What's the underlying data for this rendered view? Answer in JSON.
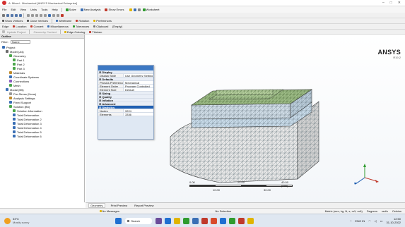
{
  "window": {
    "title": "A: Mixed - Mechanical [ANSYS Mechanical Enterprise]",
    "controls": [
      "–",
      "□",
      "✕"
    ]
  },
  "menu": [
    "File",
    "Edit",
    "View",
    "Units",
    "Tools",
    "Help"
  ],
  "toolbar1": {
    "solve": "Solve",
    "new_analysis": "New Analysis",
    "show_errors": "Show Errors",
    "worksheet": "Worksheet"
  },
  "toolbar2": {
    "show_vertices": "Show Vertices",
    "close_vertices": "Close Vertices",
    "wireframe": "Wireframe",
    "rotation": "Rotation",
    "preferences": "Preferences"
  },
  "toolbar3": {
    "edge": "Edge",
    "location": "Location",
    "convert": "Convert",
    "miscellaneous": "Miscellaneous",
    "tolerances": "Tolerances",
    "clipboard": "Clipboard",
    "empty": "[Empty]"
  },
  "toolbar4": {
    "update_project": "Update Project",
    "geometry_context": "Geometry Context",
    "edge_coloring": "Edge Coloring",
    "thicken": "Thicken"
  },
  "toolbar5": {
    "mesh": "Mesh",
    "update": "Update",
    "mesh2": "Mesh",
    "mesh_control": "Mesh Control",
    "metric_graph": "Metric Graph"
  },
  "outline": {
    "title": "Outline",
    "filter_label": "Filter:",
    "filter_value": "Name",
    "items": [
      {
        "label": "Project",
        "depth": 0,
        "color": "#3a6fb5"
      },
      {
        "label": "Model (A4)",
        "depth": 1,
        "color": "#6c6c6c"
      },
      {
        "label": "Geometry",
        "depth": 2,
        "color": "#4aa64a"
      },
      {
        "label": "Part 1",
        "depth": 3,
        "color": "#4aa64a"
      },
      {
        "label": "Part 2",
        "depth": 3,
        "color": "#4aa64a"
      },
      {
        "label": "Part 3",
        "depth": 3,
        "color": "#4aa64a"
      },
      {
        "label": "Materials",
        "depth": 2,
        "color": "#c08a2a"
      },
      {
        "label": "Coordinate Systems",
        "depth": 2,
        "color": "#3a6fb5"
      },
      {
        "label": "Connections",
        "depth": 2,
        "color": "#8a5cc0"
      },
      {
        "label": "Mesh",
        "depth": 2,
        "color": "#4aa64a"
      },
      {
        "label": "Modal (B5)",
        "depth": 1,
        "color": "#3a6fb5"
      },
      {
        "label": "Pre-Stress (None)",
        "depth": 2,
        "color": "#999999"
      },
      {
        "label": "Analysis Settings",
        "depth": 2,
        "color": "#c08a2a"
      },
      {
        "label": "Fixed Support",
        "depth": 2,
        "color": "#3a6fb5"
      },
      {
        "label": "Solution (B6)",
        "depth": 2,
        "color": "#4aa64a"
      },
      {
        "label": "Solution Information",
        "depth": 3,
        "color": "#4aa64a"
      },
      {
        "label": "Total Deformation",
        "depth": 3,
        "color": "#3a6fb5"
      },
      {
        "label": "Total Deformation 2",
        "depth": 3,
        "color": "#3a6fb5"
      },
      {
        "label": "Total Deformation 3",
        "depth": 3,
        "color": "#3a6fb5"
      },
      {
        "label": "Total Deformation 4",
        "depth": 3,
        "color": "#3a6fb5"
      },
      {
        "label": "Total Deformation 5",
        "depth": 3,
        "color": "#3a6fb5"
      },
      {
        "label": "Total Deformation 6",
        "depth": 3,
        "color": "#3a6fb5"
      }
    ]
  },
  "details": {
    "rows": [
      {
        "type": "section",
        "label": "Display"
      },
      {
        "type": "prop",
        "k": "Display Style",
        "v": "Use Geometry Setting"
      },
      {
        "type": "section",
        "label": "Defaults"
      },
      {
        "type": "prop",
        "k": "Physics Preference",
        "v": "Mechanical"
      },
      {
        "type": "prop",
        "k": "Element Order",
        "v": "Program Controlled"
      },
      {
        "type": "prop",
        "k": "Element Size",
        "v": "Default"
      },
      {
        "type": "section",
        "label": "Sizing"
      },
      {
        "type": "section",
        "label": "Quality"
      },
      {
        "type": "section",
        "label": "Inflation"
      },
      {
        "type": "section",
        "label": "Advanced"
      },
      {
        "type": "section",
        "label": "Statistics",
        "highlight": true
      },
      {
        "type": "prop",
        "k": "Nodes",
        "v": "9224"
      },
      {
        "type": "prop",
        "k": "Elements",
        "v": "3336"
      }
    ]
  },
  "viewport": {
    "brand": "ANSYS",
    "version": "R19.2",
    "scale": {
      "left": "0.00",
      "mid1": "20.00",
      "right": "40.00 (mm)",
      "sub1": "10.00",
      "sub2": "30.00"
    }
  },
  "tabs": [
    "Geometry",
    "Print Preview",
    "Report Preview"
  ],
  "status": {
    "messages": "No Messages",
    "selection": "No Selection",
    "units": "Metric (mm, kg, N, s, mV, mA)",
    "degrees": "Degrees",
    "rads": "rad/s",
    "celsius": "Celsius"
  },
  "taskbar": {
    "weather_temp": "33°C",
    "weather_desc": "Mostly sunny",
    "search": "Search",
    "language": "ENG IN",
    "time": "12:50",
    "date": "31-10-2022"
  },
  "colors": {
    "mesh_top": "#8fae78",
    "mesh_base": "#e6e6e6",
    "accent": "#3c78c3"
  }
}
